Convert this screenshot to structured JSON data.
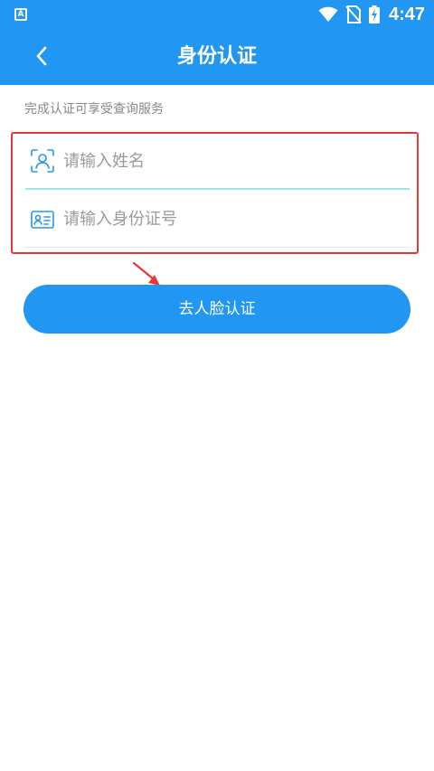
{
  "status_bar": {
    "app_icon_letter": "A",
    "time": "4:47"
  },
  "header": {
    "title": "身份认证"
  },
  "hint": "完成认证可享受查询服务",
  "form": {
    "name_field": {
      "placeholder": "请输入姓名",
      "value": ""
    },
    "id_field": {
      "placeholder": "请输入身份证号",
      "value": ""
    }
  },
  "primary_button": {
    "label": "去人脸认证"
  },
  "colors": {
    "brand": "#2196f3",
    "highlight_border": "#e53935",
    "active_underline": "#9fe3ec",
    "placeholder": "#9a9a9a"
  },
  "icons": [
    "app-icon",
    "wifi-icon",
    "no-sim-icon",
    "battery-charging-icon",
    "back-arrow-icon",
    "face-scan-icon",
    "id-card-icon",
    "red-arrow-pointer-icon"
  ]
}
